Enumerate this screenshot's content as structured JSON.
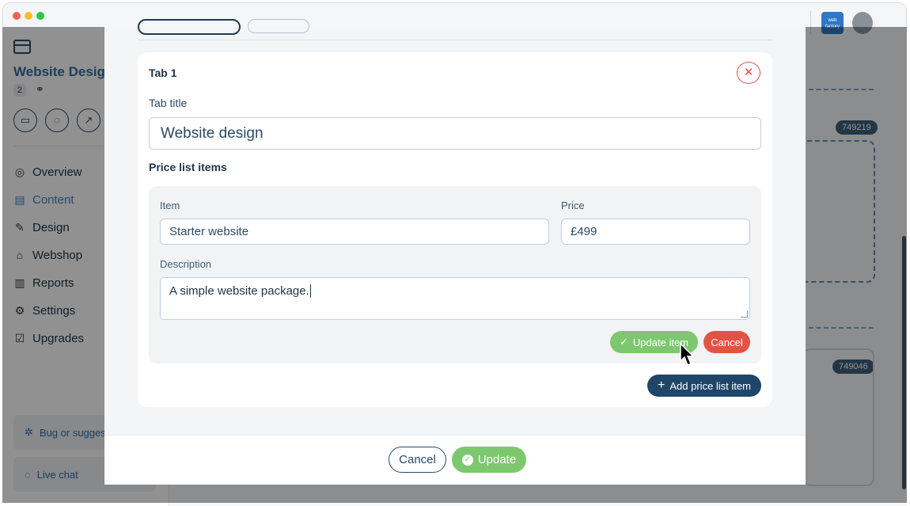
{
  "window": {
    "traffic_lights": [
      "close",
      "minimize",
      "zoom"
    ]
  },
  "sidebar": {
    "site_name": "Website Design",
    "site_count": "2",
    "nav": [
      {
        "label": "Overview",
        "icon": "compass-icon"
      },
      {
        "label": "Content",
        "icon": "layout-icon"
      },
      {
        "label": "Design",
        "icon": "design-tools-icon"
      },
      {
        "label": "Webshop",
        "icon": "basket-icon"
      },
      {
        "label": "Reports",
        "icon": "bar-chart-icon"
      },
      {
        "label": "Settings",
        "icon": "gear-icon"
      },
      {
        "label": "Upgrades",
        "icon": "upgrade-icon"
      }
    ],
    "bug_label": "Bug or suggestion",
    "live_chat_label": "Live chat"
  },
  "header": {
    "logo_text": "web factory"
  },
  "canvas": {
    "badges": [
      "749219",
      "749046"
    ]
  },
  "modal": {
    "tab": {
      "heading": "Tab 1",
      "title_label": "Tab title",
      "title_value": "Website design"
    },
    "price_list_title": "Price list items",
    "item_form": {
      "item_label": "Item",
      "item_value": "Starter website",
      "price_label": "Price",
      "price_value": "£499",
      "description_label": "Description",
      "description_value": "A simple website package.",
      "update_item_label": "Update item",
      "cancel_label": "Cancel"
    },
    "add_price_item_label": "Add price list item",
    "footer": {
      "cancel_label": "Cancel",
      "update_label": "Update"
    }
  },
  "colors": {
    "accent_navy": "#1f4668",
    "success_green": "#7dc86e",
    "danger_red": "#e35344",
    "link_blue": "#2e6ea8"
  }
}
